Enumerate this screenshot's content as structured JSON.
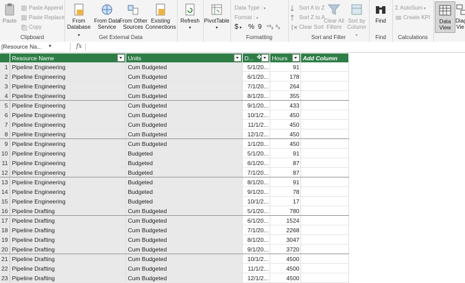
{
  "ribbon": {
    "clipboard": {
      "label": "Clipboard",
      "paste": "Paste",
      "paste_append": "Paste Append",
      "paste_replace": "Paste Replace",
      "copy": "Copy"
    },
    "external": {
      "label": "Get External Data",
      "from_database": "From\nDatabase",
      "from_data_service": "From Data\nService",
      "from_other_sources": "From Other\nSources",
      "existing_connections": "Existing\nConnections"
    },
    "refresh": "Refresh",
    "pivottable": "PivotTable",
    "formatting": {
      "label": "Formatting",
      "data_type": "Data Type :",
      "format": "Format :",
      "currency": "$",
      "percent": "%",
      "comma": "9"
    },
    "sort_filter": {
      "label": "Sort and Filter",
      "sort_a_z": "Sort A to Z",
      "sort_z_a": "Sort Z to A",
      "clear_sort": "Clear Sort",
      "clear_all_filters": "Clear All\nFilters",
      "sort_by_column": "Sort by\nColumn"
    },
    "find": {
      "label": "Find",
      "find": "Find"
    },
    "calculations": {
      "label": "Calculations",
      "autosum": "AutoSum",
      "create_kpi": "Create KPI"
    },
    "view": {
      "data_view": "Data\nView",
      "diagram_view": "Diag\nVie"
    }
  },
  "formula_bar": {
    "name_box": "[Resource Na...",
    "fx": "fx"
  },
  "columns": {
    "resource": "Resource Name",
    "units": "Units",
    "date": "D...",
    "hours": "Hours",
    "add": "Add Column"
  },
  "rows": [
    [
      "1",
      "Pipeline Engineering",
      "Cum Budgeted",
      "5/1/20...",
      "91"
    ],
    [
      "2",
      "Pipeline Engineering",
      "Cum Budgeted",
      "6/1/20...",
      "178"
    ],
    [
      "3",
      "Pipeline Engineering",
      "Cum Budgeted",
      "7/1/20...",
      "264"
    ],
    [
      "4",
      "Pipeline Engineering",
      "Cum Budgeted",
      "8/1/20...",
      "355"
    ],
    [
      "5",
      "Pipeline Engineering",
      "Cum Budgeted",
      "9/1/20...",
      "433"
    ],
    [
      "6",
      "Pipeline Engineering",
      "Cum Budgeted",
      "10/1/2...",
      "450"
    ],
    [
      "7",
      "Pipeline Engineering",
      "Cum Budgeted",
      "11/1/2...",
      "450"
    ],
    [
      "8",
      "Pipeline Engineering",
      "Cum Budgeted",
      "12/1/2...",
      "450"
    ],
    [
      "9",
      "Pipeline Engineering",
      "Cum Budgeted",
      "1/1/20...",
      "450"
    ],
    [
      "10",
      "Pipeline Engineering",
      "Budgeted",
      "5/1/20...",
      "91"
    ],
    [
      "11",
      "Pipeline Engineering",
      "Budgeted",
      "6/1/20...",
      "87"
    ],
    [
      "12",
      "Pipeline Engineering",
      "Budgeted",
      "7/1/20...",
      "87"
    ],
    [
      "13",
      "Pipeline Engineering",
      "Budgeted",
      "8/1/20...",
      "91"
    ],
    [
      "14",
      "Pipeline Engineering",
      "Budgeted",
      "9/1/20...",
      "78"
    ],
    [
      "15",
      "Pipeline Engineering",
      "Budgeted",
      "10/1/2...",
      "17"
    ],
    [
      "16",
      "Pipeline Drafting",
      "Cum Budgeted",
      "5/1/20...",
      "780"
    ],
    [
      "17",
      "Pipeline Drafting",
      "Cum Budgeted",
      "6/1/20...",
      "1524"
    ],
    [
      "18",
      "Pipeline Drafting",
      "Cum Budgeted",
      "7/1/20...",
      "2268"
    ],
    [
      "19",
      "Pipeline Drafting",
      "Cum Budgeted",
      "8/1/20...",
      "3047"
    ],
    [
      "20",
      "Pipeline Drafting",
      "Cum Budgeted",
      "9/1/20...",
      "3720"
    ],
    [
      "21",
      "Pipeline Drafting",
      "Cum Budgeted",
      "10/1/2...",
      "4500"
    ],
    [
      "22",
      "Pipeline Drafting",
      "Cum Budgeted",
      "11/1/2...",
      "4500"
    ],
    [
      "23",
      "Pipeline Drafting",
      "Cum Budgeted",
      "12/1/2...",
      "4500"
    ]
  ],
  "separator_after_rows": [
    "4",
    "8",
    "12",
    "16",
    "20"
  ],
  "colors": {
    "header_green": "#2e7d46",
    "ribbon_bg": "#f4f4f4"
  }
}
